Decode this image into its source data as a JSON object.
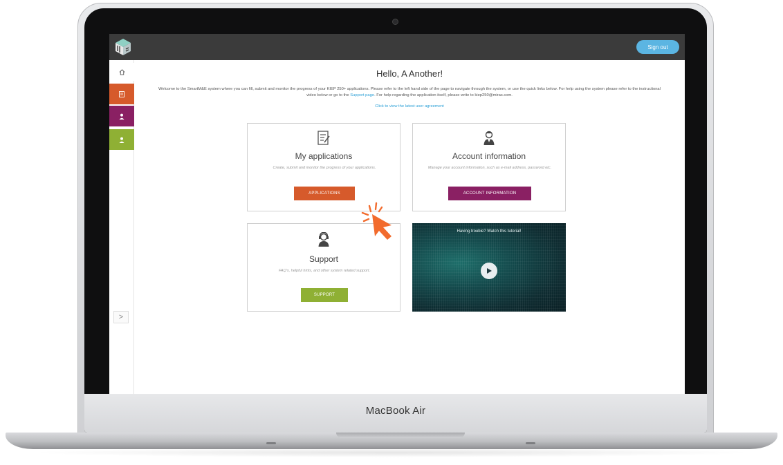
{
  "device": {
    "label": "MacBook Air"
  },
  "header": {
    "signout_label": "Sign out",
    "logo_icon": "smart-me-cube-logo"
  },
  "sidebar": {
    "items": [
      {
        "name": "home",
        "icon": "home-icon",
        "color": "#ffffff"
      },
      {
        "name": "applications",
        "icon": "document-icon",
        "color": "#d65a2b"
      },
      {
        "name": "account",
        "icon": "user-icon",
        "color": "#8a2063"
      },
      {
        "name": "support",
        "icon": "support-icon",
        "color": "#8fb034"
      }
    ],
    "expand_label": ">"
  },
  "main": {
    "greeting": "Hello, A Another!",
    "welcome_part1": "Welcome to the SmartM&E system where you can fill, submit and monitor the progress of your KIEP 250+ applications. Please refer to the left hand side of the page to navigate through the system, or use the quick links below. For help using the system please refer to the instructional video below or go to the ",
    "welcome_link": "Support page",
    "welcome_part2": ". For help regarding the application itself, please write to kiep250@miras.com.",
    "agreement_link": "Click to view the latest user agreement"
  },
  "cards": {
    "applications": {
      "title": "My applications",
      "desc": "Create, submit and monitor the progress of your applications.",
      "button": "APPLICATIONS",
      "icon": "document-edit-icon",
      "color": "#d65a2b"
    },
    "account": {
      "title": "Account information",
      "desc": "Manage your account information, such as e-mail address, password etc.",
      "button": "ACCOUNT INFORMATION",
      "icon": "user-icon",
      "color": "#8a2063"
    },
    "support": {
      "title": "Support",
      "desc": "FAQ's, helpful hints, and other system related support.",
      "button": "SUPPORT",
      "icon": "support-agent-icon",
      "color": "#8fb034"
    },
    "video": {
      "title": "Having trouble? Watch this tutorial!",
      "icon": "play-icon"
    }
  },
  "cursor": {
    "icon": "click-pointer-icon",
    "color": "#f26b2d"
  }
}
